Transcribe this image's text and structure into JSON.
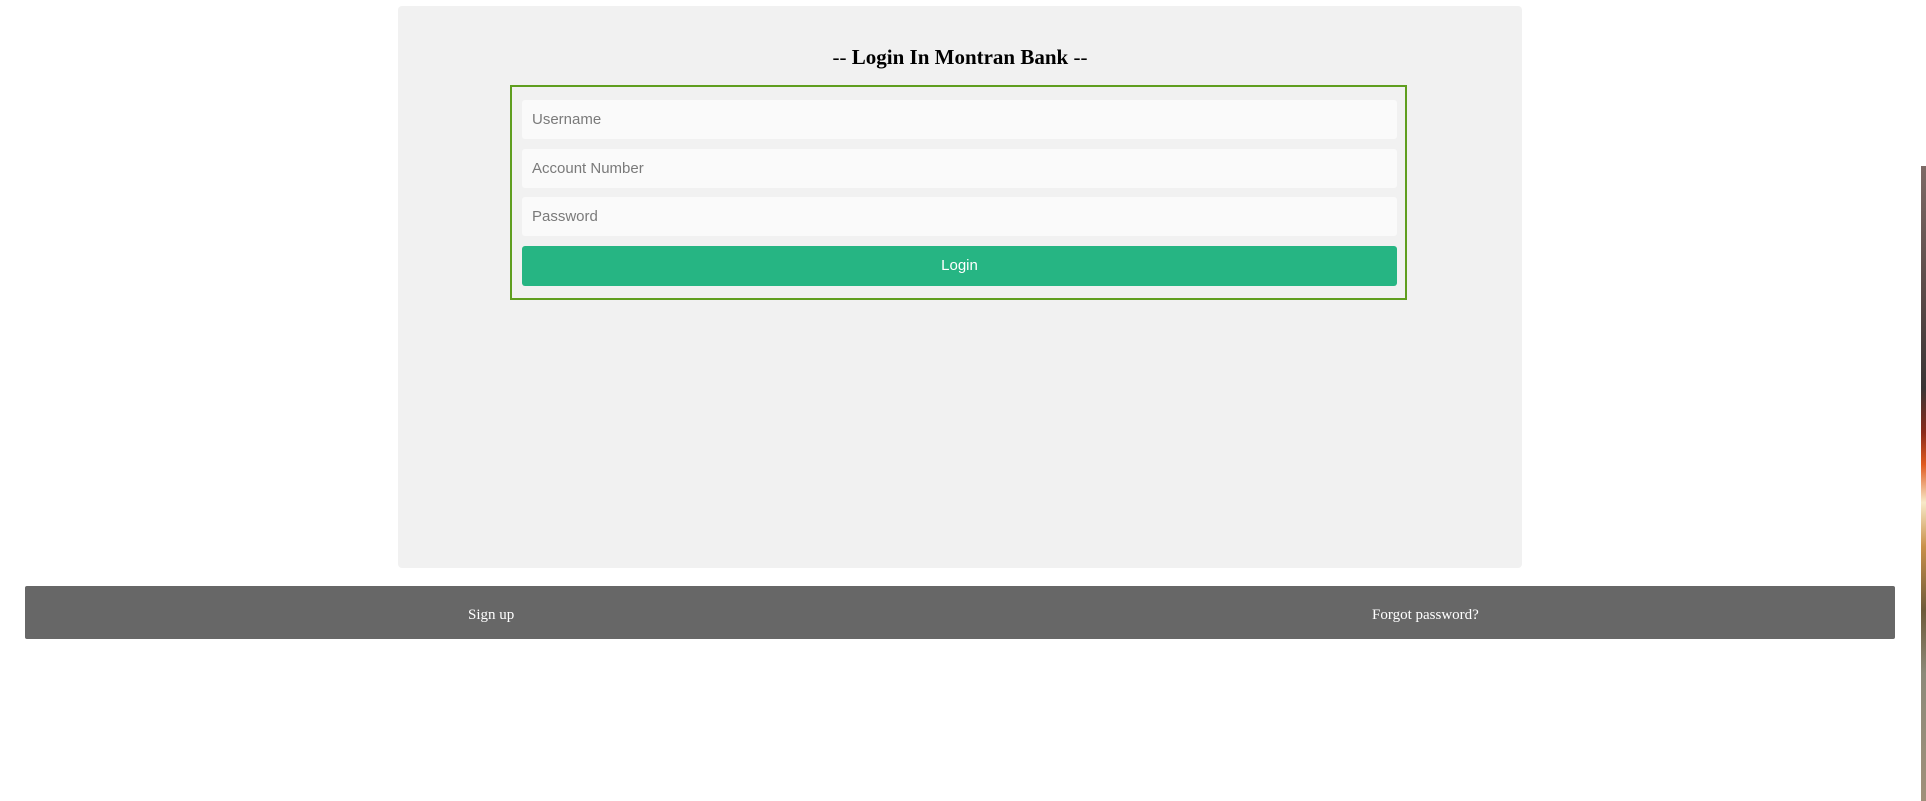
{
  "login": {
    "title_prefix": "--",
    "title_main": "Login In Montran Bank",
    "title_suffix": "--",
    "username_placeholder": "Username",
    "account_placeholder": "Account Number",
    "password_placeholder": "Password",
    "login_label": "Login"
  },
  "footer": {
    "signup_label": "Sign up",
    "forgot_label": "Forgot password?"
  },
  "colors": {
    "panel_bg": "#f1f1f1",
    "form_border": "#5f9e1f",
    "login_button": "#26b583",
    "footer_bg": "#676767"
  }
}
